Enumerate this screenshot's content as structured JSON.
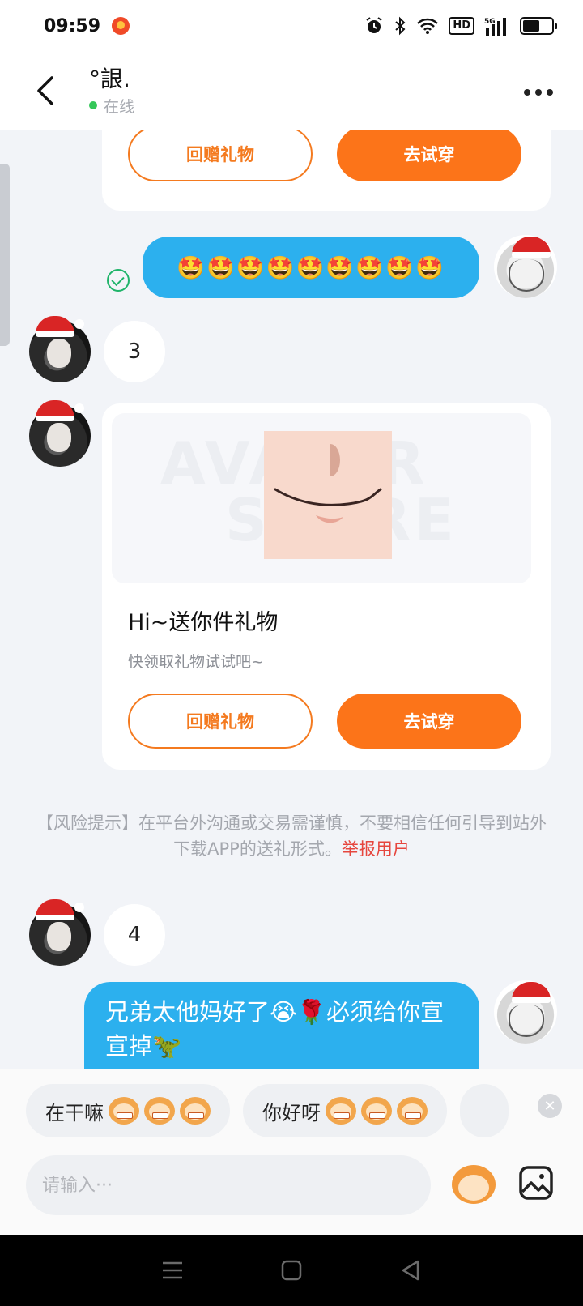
{
  "status_bar": {
    "time": "09:59",
    "hd": "HD",
    "network": "5G",
    "battery_level": 0.6
  },
  "header": {
    "title": "°詪.",
    "status": "在线"
  },
  "gift_card_top": {
    "return_gift": "回赠礼物",
    "try_on": "去试穿"
  },
  "msg_emojis": "🤩🤩🤩🤩🤩🤩🤩🤩🤩",
  "msg_3": "3",
  "gift_card": {
    "watermark_1": "AVATAR",
    "watermark_2": "STORE",
    "title": "Hi~送你件礼物",
    "subtitle": "快领取礼物试试吧~",
    "return_gift": "回赠礼物",
    "try_on": "去试穿"
  },
  "notice": {
    "text": "【风险提示】在平台外沟通或交易需谨慎，不要相信任何引导到站外下载APP的送礼形式。",
    "link": "举报用户"
  },
  "msg_4": "4",
  "msg_long": "兄弟太他妈好了😭🌹必须给你宣宣掉🦖",
  "quick_replies": [
    {
      "text": "在干嘛"
    },
    {
      "text": "你好呀"
    }
  ],
  "input": {
    "placeholder": "请输入···"
  },
  "colors": {
    "accent": "#fc7419",
    "bubble_me": "#2cb0ee",
    "online": "#34c759",
    "report": "#e6463e"
  },
  "icons": [
    "back-arrow-icon",
    "more-icon",
    "read-check-icon",
    "close-icon",
    "sticker-icon",
    "image-icon",
    "menu-icon",
    "home-icon",
    "back-icon"
  ]
}
